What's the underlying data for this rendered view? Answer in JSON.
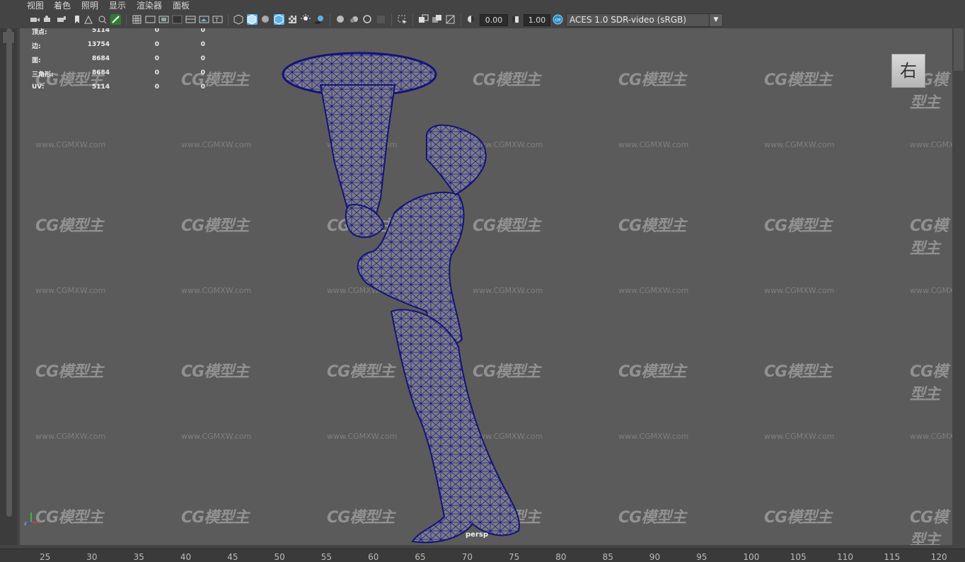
{
  "menu": [
    "视图",
    "着色",
    "照明",
    "显示",
    "渲染器",
    "面板"
  ],
  "toolbar": {
    "exposure_value": "0.00",
    "gamma_value": "1.00",
    "color_space": "ACES 1.0 SDR-video (sRGB)"
  },
  "hud": [
    {
      "label": "顶点:",
      "v1": "5114",
      "v2": "0",
      "v3": "0"
    },
    {
      "label": "边:",
      "v1": "13754",
      "v2": "0",
      "v3": "0"
    },
    {
      "label": "面:",
      "v1": "8684",
      "v2": "0",
      "v3": "0"
    },
    {
      "label": "三角形:",
      "v1": "8684",
      "v2": "0",
      "v3": "0"
    },
    {
      "label": "UV:",
      "v1": "5114",
      "v2": "0",
      "v3": "0"
    }
  ],
  "viewcube_label": "右",
  "camera_name": "persp",
  "watermark": {
    "logo": "CG模型主",
    "url": "www.CGMXW.com"
  },
  "ruler_ticks": [
    "25",
    "30",
    "35",
    "40",
    "45",
    "50",
    "55",
    "60",
    "65",
    "70",
    "75",
    "80",
    "85",
    "90",
    "95",
    "100",
    "105",
    "110",
    "115",
    "120"
  ],
  "colors": {
    "viewport_bg": "#5b5b5b",
    "wireframe": "#1a1a8a",
    "mesh_fill": "#7d7d84",
    "accent": "#5ab3e6"
  }
}
